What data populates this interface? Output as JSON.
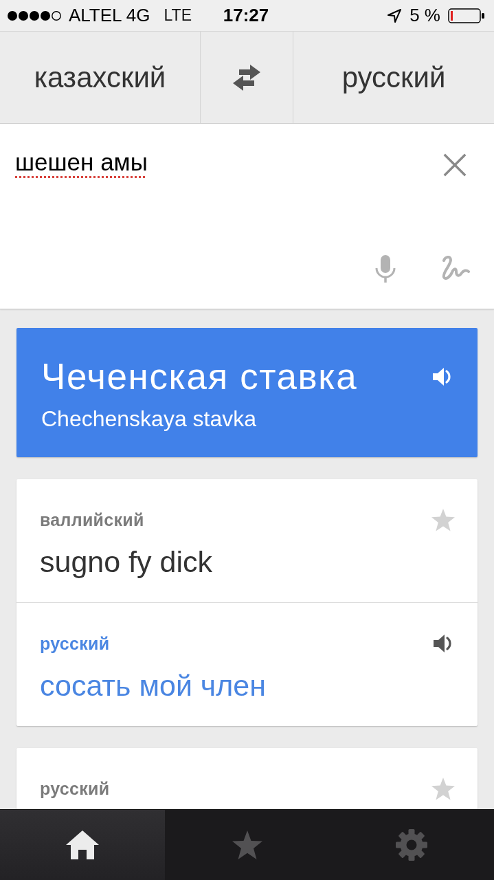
{
  "status_bar": {
    "carrier": "ALTEL 4G",
    "network": "LTE",
    "time": "17:27",
    "battery": "5 %"
  },
  "language_bar": {
    "source": "казахский",
    "target": "русский"
  },
  "input": {
    "value": "шешен амы",
    "misspelled": true
  },
  "translation": {
    "text": "Чеченская ставка",
    "transliteration": "Chechenskaya stavka"
  },
  "cards": [
    {
      "sections": [
        {
          "kind": "source",
          "language": "валлийский",
          "text": "sugno fy dick"
        },
        {
          "kind": "translation",
          "language": "русский",
          "text": "сосать мой член"
        }
      ]
    },
    {
      "sections": [
        {
          "kind": "source",
          "language": "русский"
        }
      ]
    }
  ],
  "tab_bar": {
    "tabs": [
      {
        "selected": true
      },
      {
        "selected": false
      },
      {
        "selected": false
      }
    ]
  }
}
